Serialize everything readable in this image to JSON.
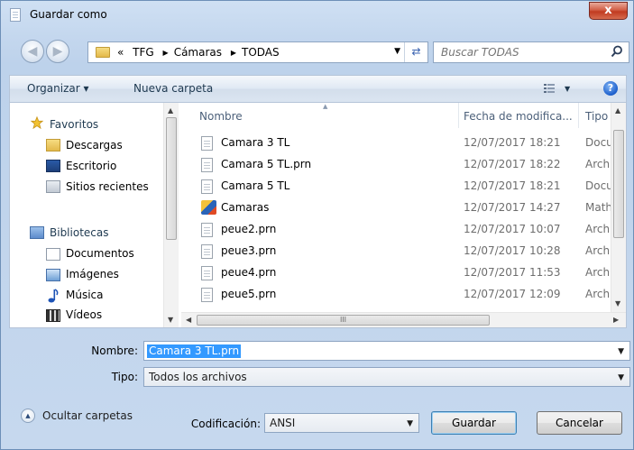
{
  "window": {
    "title": "Guardar como",
    "close_symbol": "x"
  },
  "address": {
    "crumbs_prefix": "«",
    "crumbs": [
      "TFG",
      "Cámaras",
      "TODAS"
    ],
    "search_placeholder": "Buscar TODAS"
  },
  "toolbar": {
    "organize_label": "Organizar ▾",
    "new_folder_label": "Nueva carpeta",
    "help_symbol": "?"
  },
  "nav": {
    "favorites_label": "Favoritos",
    "favorites": [
      "Descargas",
      "Escritorio",
      "Sitios recientes"
    ],
    "libraries_label": "Bibliotecas",
    "libraries": [
      "Documentos",
      "Imágenes",
      "Música",
      "Vídeos"
    ]
  },
  "files": {
    "columns": {
      "name": "Nombre",
      "date": "Fecha de modifica...",
      "type": "Tipo"
    },
    "rows": [
      {
        "name": "Camara 3 TL",
        "date": "12/07/2017 18:21",
        "type": "Docun",
        "icon": "document-icon"
      },
      {
        "name": "Camara 5 TL.prn",
        "date": "12/07/2017 18:22",
        "type": "Archiv",
        "icon": "document-icon"
      },
      {
        "name": "Camara 5 TL",
        "date": "12/07/2017 18:21",
        "type": "Docun",
        "icon": "document-icon"
      },
      {
        "name": "Camaras",
        "date": "12/07/2017 14:27",
        "type": "Mathc",
        "icon": "mathcad-icon"
      },
      {
        "name": "peue2.prn",
        "date": "12/07/2017 10:07",
        "type": "Archiv",
        "icon": "document-icon"
      },
      {
        "name": "peue3.prn",
        "date": "12/07/2017 10:28",
        "type": "Archiv",
        "icon": "document-icon"
      },
      {
        "name": "peue4.prn",
        "date": "12/07/2017 11:53",
        "type": "Archiv",
        "icon": "document-icon"
      },
      {
        "name": "peue5.prn",
        "date": "12/07/2017 12:09",
        "type": "Archiv",
        "icon": "document-icon"
      }
    ],
    "hscroll_grip": "III"
  },
  "save": {
    "name_label": "Nombre:",
    "name_value": "Camara 3 TL.prn",
    "type_label": "Tipo:",
    "type_value": "Todos los archivos",
    "encoding_label": "Codificación:",
    "encoding_value": "ANSI"
  },
  "buttons": {
    "hide_folders": "Ocultar carpetas",
    "save": "Guardar",
    "cancel": "Cancelar"
  },
  "colors": {
    "selection": "#3399ff",
    "frame": "#c4d7ee",
    "close": "#c13b20"
  }
}
